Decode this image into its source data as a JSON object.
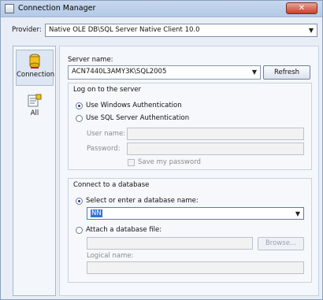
{
  "window": {
    "title": "Connection Manager",
    "close_glyph": "✕"
  },
  "provider": {
    "label": "Provider:",
    "value": "Native OLE DB\\SQL Server Native Client 10.0"
  },
  "nav": {
    "items": [
      {
        "label": "Connection",
        "icon": "database-icon",
        "active": true
      },
      {
        "label": "All",
        "icon": "properties-icon",
        "active": false
      }
    ]
  },
  "server": {
    "label": "Server name:",
    "value": "ACN7440L3AMY3K\\SQL2005",
    "refresh_label": "Refresh"
  },
  "logon": {
    "title": "Log on to the server",
    "windows_auth_label": "Use Windows Authentication",
    "sql_auth_label": "Use SQL Server Authentication",
    "username_label": "User name:",
    "password_label": "Password:",
    "save_password_label": "Save my password",
    "windows_auth_checked": true
  },
  "database": {
    "title": "Connect to a database",
    "select_label": "Select or enter a database name:",
    "select_value": "NN",
    "attach_label": "Attach a database file:",
    "browse_label": "Browse...",
    "logical_name_label": "Logical name:",
    "select_checked": true
  },
  "combo_arrow": "▼"
}
